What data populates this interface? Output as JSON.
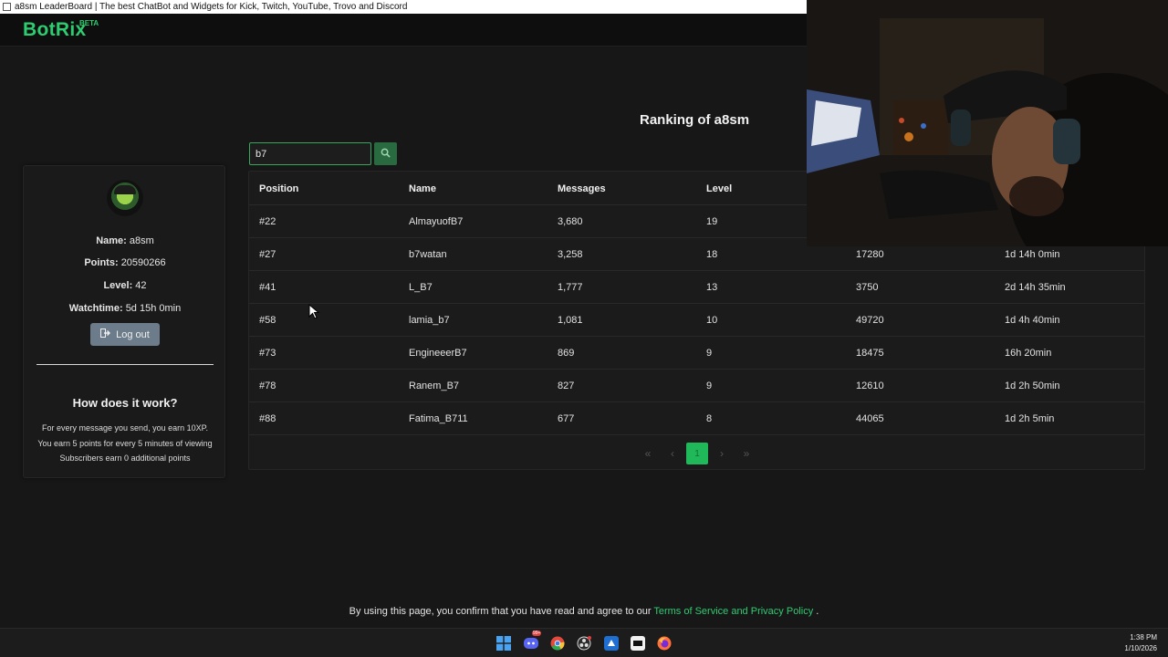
{
  "window": {
    "title": "a8sm LeaderBoard | The best ChatBot and Widgets for Kick, Twitch, YouTube, Trovo and Discord"
  },
  "header": {
    "logo": "BotRix",
    "badge": "BETA"
  },
  "page": {
    "heading": "Ranking of a8sm"
  },
  "search": {
    "value": "b7"
  },
  "profile": {
    "name_label": "Name:",
    "name": "a8sm",
    "points_label": "Points:",
    "points": "20590266",
    "level_label": "Level:",
    "level": "42",
    "watchtime_label": "Watchtime:",
    "watchtime": "5d 15h 0min",
    "logout_label": "Log out"
  },
  "how": {
    "title": "How does it work?",
    "lines": [
      "For every message you send, you earn 10XP.",
      "You earn 5 points for every 5 minutes of viewing",
      "Subscribers earn 0 additional points"
    ]
  },
  "table": {
    "columns": [
      "Position",
      "Name",
      "Messages",
      "Level",
      "",
      ""
    ],
    "rows": [
      [
        "#22",
        "AlmayuofB7",
        "3,680",
        "19",
        "",
        ""
      ],
      [
        "#27",
        "b7watan",
        "3,258",
        "18",
        "17280",
        "1d 14h 0min"
      ],
      [
        "#41",
        "L_B7",
        "1,777",
        "13",
        "3750",
        "2d 14h 35min"
      ],
      [
        "#58",
        "lamia_b7",
        "1,081",
        "10",
        "49720",
        "1d 4h 40min"
      ],
      [
        "#73",
        "EngineeerB7",
        "869",
        "9",
        "18475",
        "16h 20min"
      ],
      [
        "#78",
        "Ranem_B7",
        "827",
        "9",
        "12610",
        "1d 2h 50min"
      ],
      [
        "#88",
        "Fatima_B711",
        "677",
        "8",
        "44065",
        "1d 2h 5min"
      ]
    ]
  },
  "pagination": {
    "first": "«",
    "prev": "‹",
    "current": "1",
    "next": "›",
    "last": "»"
  },
  "footer": {
    "text": "By using this page, you confirm that you have read and agree to our",
    "link": "Terms of Service and Privacy Policy",
    "end": "."
  },
  "taskbar": {
    "time": "1:38 PM",
    "date": "1/10/2026",
    "discord_badge": "99+",
    "icons": [
      "windows-start-icon",
      "discord-icon",
      "chrome-icon",
      "obs-icon",
      "app-icon",
      "capcut-icon",
      "firefox-icon"
    ]
  },
  "colors": {
    "accent": "#2ecc71",
    "button_dark": "#2a6a40",
    "logout": "#6c7c8a",
    "page_current": "#1fb95a"
  }
}
